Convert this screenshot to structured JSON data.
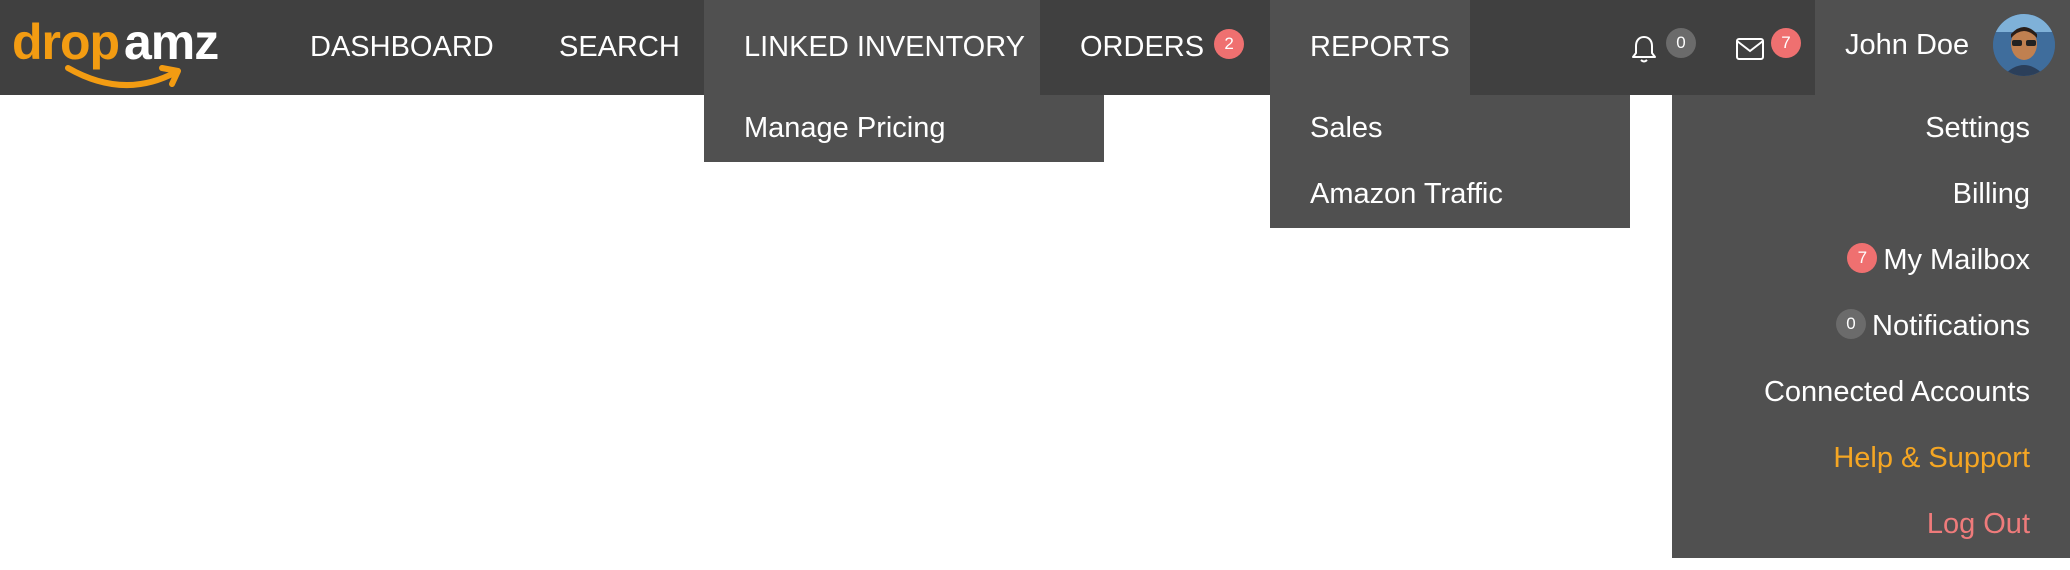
{
  "brand": {
    "logo_part1": "drop",
    "logo_part2": "amz",
    "accent_color": "#f39c12"
  },
  "nav": {
    "dashboard": "DASHBOARD",
    "search": "SEARCH",
    "linked_inventory": "LINKED INVENTORY",
    "orders": "ORDERS",
    "orders_badge": "2",
    "reports": "REPORTS"
  },
  "header_icons": {
    "bell_icon": "bell-icon",
    "bell_badge": "0",
    "mail_icon": "envelope-icon",
    "mail_badge": "7"
  },
  "user": {
    "name": "John Doe",
    "avatar_icon": "avatar"
  },
  "linked_inventory_menu": {
    "items": [
      "Manage Pricing"
    ]
  },
  "reports_menu": {
    "items": [
      "Sales",
      "Amazon Traffic"
    ]
  },
  "user_menu": {
    "settings": "Settings",
    "billing": "Billing",
    "mailbox_badge": "7",
    "mailbox": "My Mailbox",
    "notifications_badge": "0",
    "notifications": "Notifications",
    "connected_accounts": "Connected Accounts",
    "help_support": "Help & Support",
    "log_out": "Log Out"
  },
  "colors": {
    "navbar_bg": "#404040",
    "active_bg": "#505050",
    "badge_red": "#ef7070",
    "badge_gray": "#6b6b6b",
    "help_color": "#f5a623",
    "logout_color": "#ef7b7b"
  }
}
